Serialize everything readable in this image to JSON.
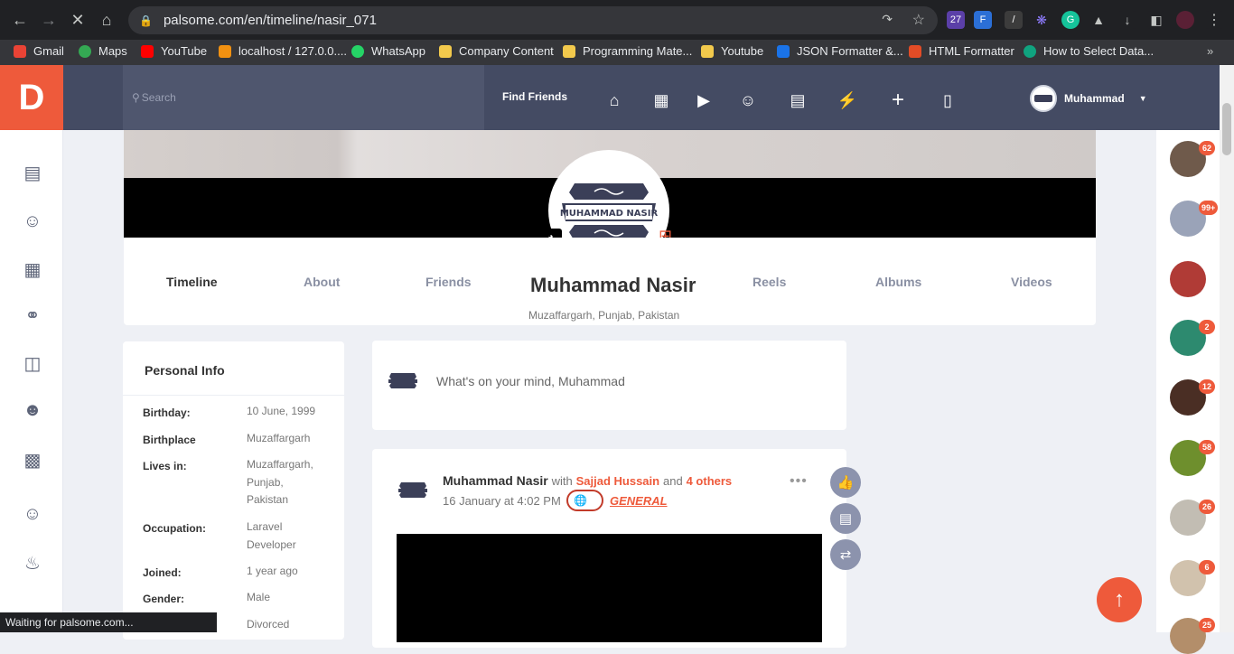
{
  "browser": {
    "url": "palsome.com/en/timeline/nasir_071",
    "ext_badge": "27",
    "bookmarks": [
      "Gmail",
      "Maps",
      "YouTube",
      "localhost / 127.0.0....",
      "WhatsApp",
      "Company Content",
      "Programming Mate...",
      "Youtube",
      "JSON Formatter &...",
      "HTML Formatter",
      "How to Select Data..."
    ],
    "status": "Waiting for palsome.com..."
  },
  "header": {
    "logo": "D",
    "search_placeholder": "Search",
    "find_friends": "Find Friends",
    "user_name": "Muhammad",
    "nav_icons": [
      "home-icon",
      "store-icon",
      "play-icon",
      "smile-icon",
      "chat-cards-icon",
      "lightning-icon",
      "plus-icon",
      "message-icon"
    ]
  },
  "left_sidebar": {
    "icons": [
      "newsfeed-icon",
      "sticker-icon",
      "marketplace-icon",
      "mosque-icon",
      "calendar-icon",
      "groups-icon",
      "blog-icon",
      "face-icon",
      "bell-icon"
    ]
  },
  "profile": {
    "name": "Muhammad Nasir",
    "location": "Muzaffargarh, Punjab, Pakistan",
    "emblem_text": "MUHAMMAD NASIR",
    "tabs": [
      "Timeline",
      "About",
      "Friends",
      "Reels",
      "Albums",
      "Videos"
    ]
  },
  "personal_info": {
    "title": "Personal Info",
    "rows": [
      {
        "label": "Birthday:",
        "value": "10 June, 1999"
      },
      {
        "label": "Birthplace",
        "value": "Muzaffargarh"
      },
      {
        "label": "Lives in:",
        "value": "Muzaffargarh,\nPunjab,\nPakistan"
      },
      {
        "label": "Occupation:",
        "value": "Laravel\nDeveloper"
      },
      {
        "label": "Joined:",
        "value": "1 year ago"
      },
      {
        "label": "Gender:",
        "value": "Male"
      },
      {
        "label": "",
        "value": "Divorced"
      }
    ]
  },
  "composer": {
    "placeholder": "What's on your mind, Muhammad"
  },
  "post": {
    "author": "Muhammad Nasir",
    "with": "with",
    "tagged": "Sajjad Hussain",
    "and": "and",
    "others": "4 others",
    "date": "16 January at 4:02 PM",
    "category": "GENERAL"
  },
  "friends_badges": [
    "62",
    "99+",
    "",
    "2",
    "12",
    "58",
    "26",
    "6",
    "25"
  ],
  "colors": {
    "accent": "#ee5a3b",
    "header": "#444b63",
    "background": "#eef0f5"
  }
}
